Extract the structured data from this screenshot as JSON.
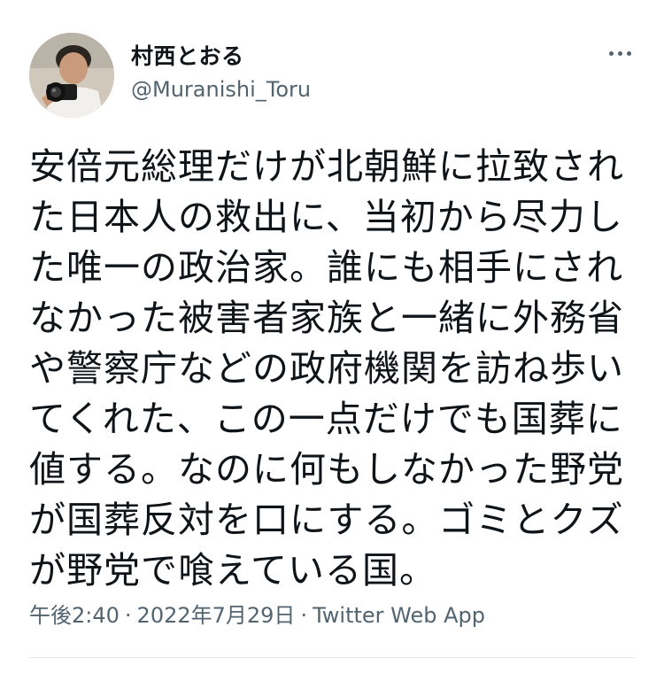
{
  "user": {
    "display_name": "村西とおる",
    "handle": "@Muranishi_Toru",
    "avatar_icon": "profile-photo-man-with-camera"
  },
  "more_icon": "more-horizontal-icon",
  "tweet": {
    "lines": [
      "安倍元総理だけが北朝鮮に拉致され",
      "た日本人の救出に、当初から尽力し",
      "た唯一の政治家。誰にも相手にされ",
      "なかった被害者家族と一緒に外務省",
      "や警察庁などの政府機関を訪ね歩い",
      "てくれた、この一点だけでも国葬に",
      "値する。なのに何もしなかった野党",
      "が国葬反対を口にする。ゴミとクズ",
      "が野党で喰えている国。"
    ]
  },
  "meta": {
    "time": "午後2:40",
    "separator": "·",
    "date": "2022年7月29日",
    "source": "Twitter Web App"
  },
  "colors": {
    "text": "#0f1419",
    "secondary": "#536471",
    "divider": "#e1e8ed"
  }
}
